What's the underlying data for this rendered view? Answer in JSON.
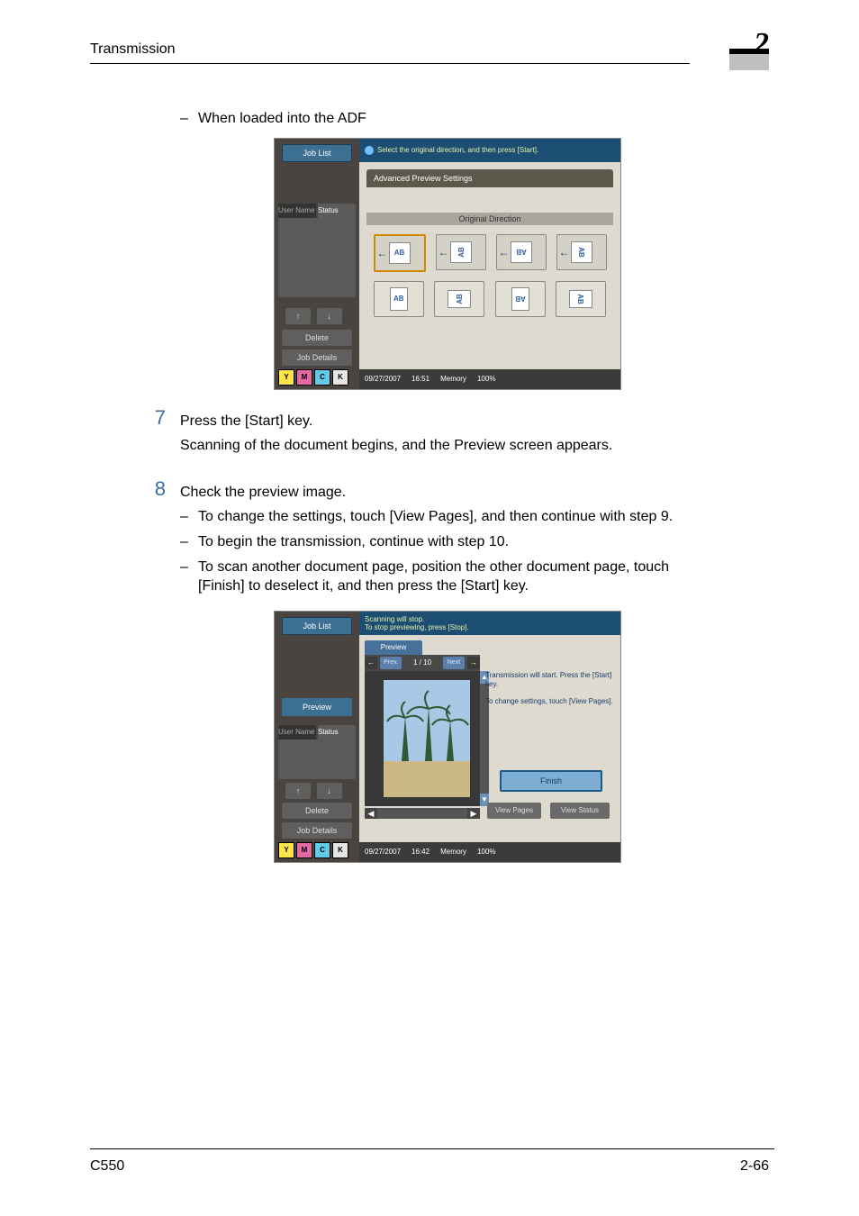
{
  "header": {
    "title": "Transmission",
    "chapter": "2"
  },
  "footer": {
    "left": "C550",
    "right": "2-66"
  },
  "body": {
    "bullet0": "When loaded into the ADF",
    "step7_num": "7",
    "step7_line1": "Press the [Start] key.",
    "step7_line2": "Scanning of the document begins, and the Preview screen appears.",
    "step8_num": "8",
    "step8_line1": "Check the preview image.",
    "step8_b1": "To change the settings, touch [View Pages], and then continue with step 9.",
    "step8_b2": "To begin the transmission, continue with step 10.",
    "step8_b3": "To scan another document page, position the other document page, touch [Finish] to deselect it, and then press the [Start] key.",
    "dash": "–"
  },
  "panel1": {
    "side": {
      "joblist": "Job List",
      "tab1": "User Name",
      "tab2": "Status",
      "delete": "Delete",
      "details": "Job Details",
      "ymck": {
        "y": "Y",
        "m": "M",
        "c": "C",
        "k": "K"
      }
    },
    "top": "Select the original direction, and then press [Start].",
    "settings_banner": "Advanced Preview Settings",
    "direction_label": "Original Direction",
    "glyph_ab_h": "AB",
    "glyph_ab_v": "AB",
    "bottom": {
      "date": "09/27/2007",
      "time": "16:51",
      "mem_label": "Memory",
      "mem": "100%"
    }
  },
  "panel2": {
    "side": {
      "joblist": "Job List",
      "preview": "Preview",
      "tab1": "User Name",
      "tab2": "Status",
      "delete": "Delete",
      "details": "Job Details",
      "ymck": {
        "y": "Y",
        "m": "M",
        "c": "C",
        "k": "K"
      }
    },
    "top": "Scanning will stop.\nTo stop previewing, press [Stop].",
    "pager": {
      "prev": "Prev. Page",
      "count_cur": "1",
      "count_sep": "/",
      "count_tot": "10",
      "next": "Next Page",
      "left": "←",
      "right": "→"
    },
    "msg1": "Transmission will start. Press the [Start] key.",
    "msg2": "To change settings, touch [View Pages].",
    "finish": "Finish",
    "viewpages": "View Pages",
    "viewstatus": "View Status",
    "tab_label": "Preview",
    "bottom": {
      "date": "09/27/2007",
      "time": "16:42",
      "mem_label": "Memory",
      "mem": "100%"
    }
  }
}
